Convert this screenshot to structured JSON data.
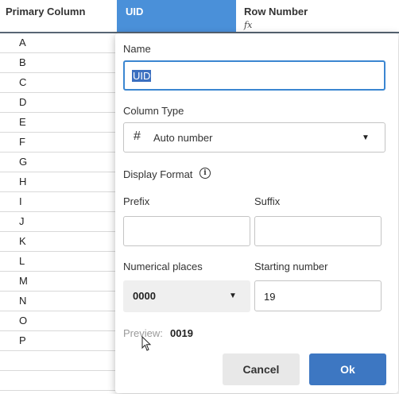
{
  "grid": {
    "columns": [
      "Primary Column",
      "UID",
      "Row Number"
    ],
    "rownum_icon": "fx-icon",
    "rows": [
      "A",
      "B",
      "C",
      "D",
      "E",
      "F",
      "G",
      "H",
      "I",
      "J",
      "K",
      "L",
      "M",
      "N",
      "O",
      "P",
      "",
      ""
    ]
  },
  "dialog": {
    "name_label": "Name",
    "name_value": "UID",
    "column_type_label": "Column Type",
    "column_type_icon": "#",
    "column_type_value": "Auto number",
    "display_format_label": "Display Format",
    "info_icon": "i",
    "prefix_label": "Prefix",
    "prefix_value": "",
    "suffix_label": "Suffix",
    "suffix_value": "",
    "numerical_places_label": "Numerical places",
    "numerical_places_value": "0000",
    "starting_number_label": "Starting number",
    "starting_number_value": "19",
    "preview_label": "Preview:",
    "preview_value": "0019",
    "cancel_label": "Cancel",
    "ok_label": "Ok",
    "caret_glyph": "▼"
  },
  "colors": {
    "selected_header": "#4a90d9",
    "ok_button": "#3d77c2",
    "focus_border": "#3b86d1"
  }
}
